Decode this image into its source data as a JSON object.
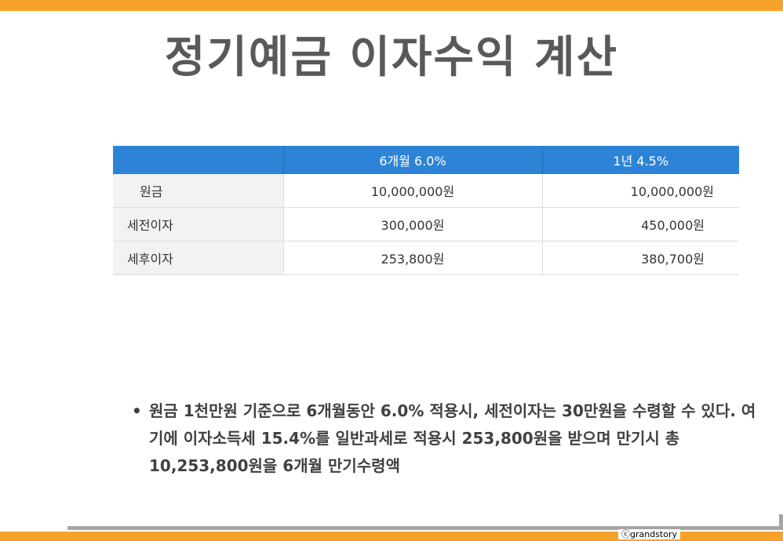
{
  "slide": {
    "title": "정기예금 이자수익 계산"
  },
  "table": {
    "headers": [
      "",
      "6개월 6.0%",
      "1년 4.5%"
    ],
    "rows": [
      {
        "label": "원금",
        "v1": "10,000,000원",
        "v2": "10,000,000원"
      },
      {
        "label": "세전이자",
        "v1": "300,000원",
        "v2": "450,000원"
      },
      {
        "label": "세후이자",
        "v1": "253,800원",
        "v2": "380,700원"
      }
    ]
  },
  "bullet": {
    "marker": "•",
    "text": "원금 1천만원 기준으로 6개월동안 6.0% 적용시, 세전이자는 30만원을 수령할 수 있다. 여기에 이자소득세 15.4%를 일반과세로 적용시 253,800원을 받으며 만기시 총 10,253,800원을 6개월 만기수령액"
  },
  "footer": {
    "copyright": "ⓒgrandstory"
  },
  "colors": {
    "accent_bar": "#f7a12b",
    "table_header": "#2d84d6",
    "title_text": "#595959"
  }
}
